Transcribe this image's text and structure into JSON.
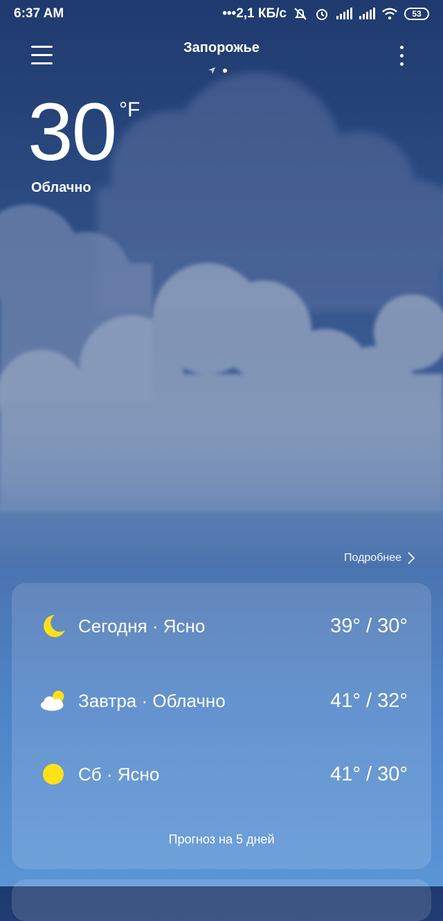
{
  "status_bar": {
    "time": "6:37 AM",
    "speed": "•••2,1 КБ/с",
    "battery": "53",
    "icons": [
      "mute-bell-icon",
      "alarm-icon",
      "signal-icon",
      "signal-icon",
      "wifi-icon",
      "battery-icon"
    ]
  },
  "header": {
    "city": "Запорожье",
    "menu_icon": "hamburger-icon",
    "more_icon": "more-vertical-icon",
    "location_icon": "location-arrow-icon"
  },
  "current": {
    "temperature": "30",
    "unit": "°F",
    "condition": "Облачно"
  },
  "details_link": "Подробнее",
  "forecast": {
    "rows": [
      {
        "label": "Сегодня · Ясно",
        "temps": "39° / 30°",
        "icon": "moon-icon"
      },
      {
        "label": "Завтра · Облачно",
        "temps": "41° / 32°",
        "icon": "partly-cloudy-icon"
      },
      {
        "label": "Сб · Ясно",
        "temps": "41° / 30°",
        "icon": "sun-icon"
      }
    ],
    "button": "Прогноз на 5 дней"
  },
  "colors": {
    "icon_yellow": "#ffe11a",
    "background_top": "#1f3a6e",
    "background_bottom": "#5b95d6"
  }
}
